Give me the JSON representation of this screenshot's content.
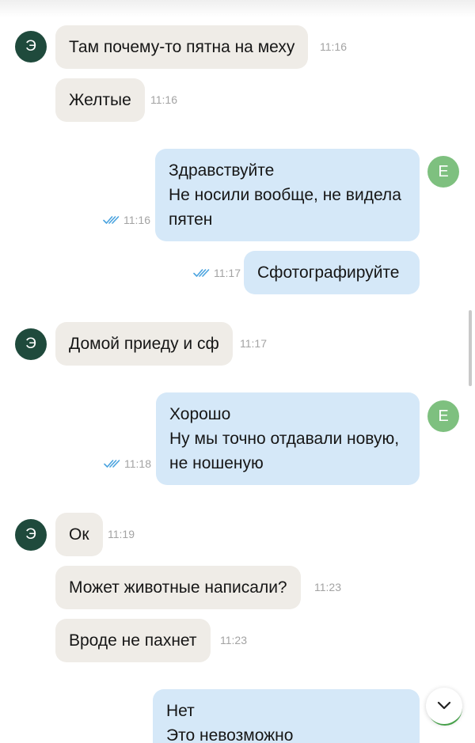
{
  "messages": [
    {
      "avatar": "Э",
      "text": [
        "Там почему-то пятна на меху"
      ],
      "time": "11:16"
    },
    {
      "text": [
        "Желтые"
      ],
      "time": "11:16"
    },
    {
      "avatar": "Е",
      "text": [
        "Здравствуйте",
        "Не носили вообще, не видела",
        "пятен"
      ],
      "time": "11:16",
      "read": true
    },
    {
      "text": [
        "Сфотографируйте"
      ],
      "time": "11:17",
      "read": true
    },
    {
      "avatar": "Э",
      "text": [
        "Домой приеду и сф"
      ],
      "time": "11:17"
    },
    {
      "avatar": "Е",
      "text": [
        "Хорошо",
        "Ну мы точно отдавали новую,",
        "не ношеную"
      ],
      "time": "11:18",
      "read": true
    },
    {
      "avatar": "Э",
      "text": [
        "Ок"
      ],
      "time": "11:19"
    },
    {
      "text": [
        "Может животные написали?"
      ],
      "time": "11:23"
    },
    {
      "text": [
        "Вроде не пахнет"
      ],
      "time": "11:23"
    },
    {
      "text": [
        "Нет",
        "Это невозможно"
      ]
    }
  ],
  "colors": {
    "incoming_bubble": "#efece7",
    "outgoing_bubble": "#d5e8f8",
    "their_avatar": "#1f4a3c",
    "my_avatar": "#7ec07f",
    "read_ticks": "#4aa3df"
  },
  "icons": {
    "read_status": "double-check-icon",
    "scroll_down": "chevron-down-icon"
  }
}
